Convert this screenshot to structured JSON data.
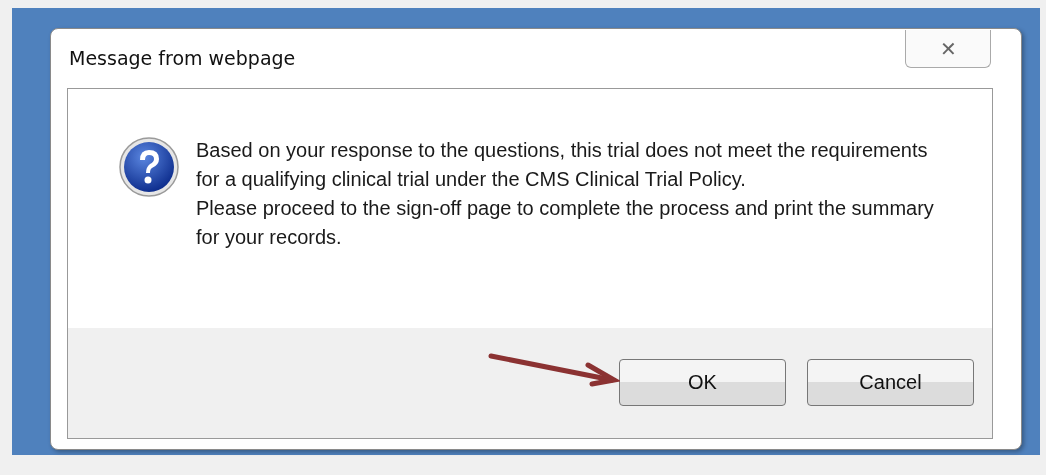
{
  "dialog": {
    "title": "Message from webpage",
    "close_symbol": "✕",
    "message": [
      "Based on your response to the questions, this trial does not meet the requirements for a qualifying clinical trial under the CMS Clinical Trial Policy.",
      "Please proceed to the sign-off page to complete the process and print the summary for your records."
    ],
    "buttons": [
      "OK",
      "Cancel"
    ]
  }
}
